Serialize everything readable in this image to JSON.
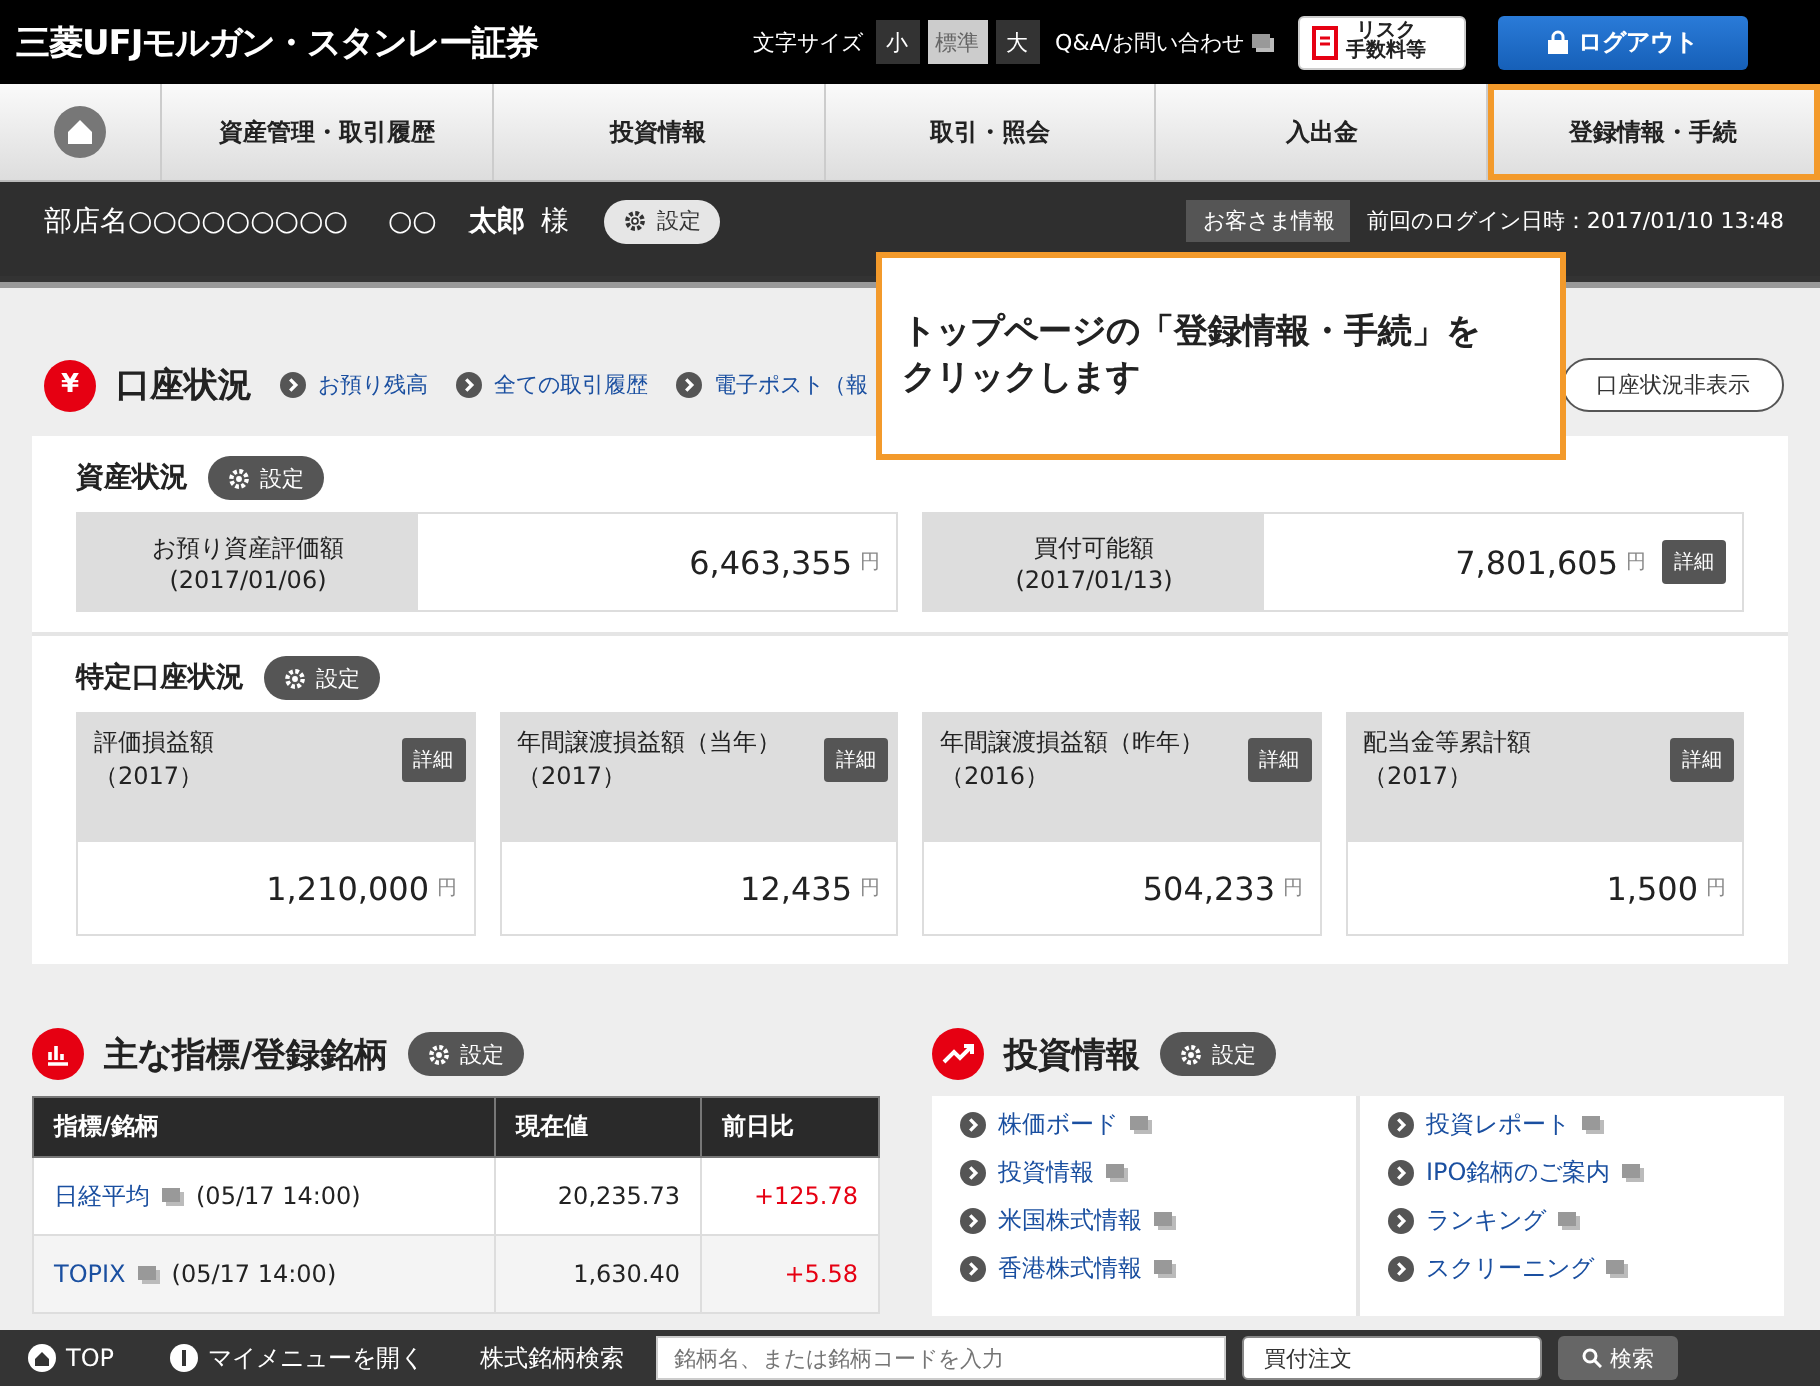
{
  "header": {
    "logo": "三菱UFJモルガン・スタンレー証券",
    "font_size_label": "文字サイズ",
    "font_sizes": [
      {
        "label": "小",
        "selected": false
      },
      {
        "label": "標準",
        "selected": true
      },
      {
        "label": "大",
        "selected": false
      }
    ],
    "help_link": "Q&A/お問い合わせ",
    "risk_button": [
      "リスク",
      "手数料等"
    ],
    "logout_button": "ログアウト"
  },
  "nav": [
    {
      "label": "資産管理・取引履歴",
      "highlighted": false
    },
    {
      "label": "投資情報",
      "highlighted": false
    },
    {
      "label": "取引・照会",
      "highlighted": false
    },
    {
      "label": "入出金",
      "highlighted": false
    },
    {
      "label": "登録情報・手続",
      "highlighted": true
    }
  ],
  "user_bar": {
    "branch": "部店名○○○○○○○○○",
    "surname": "○○",
    "given_name": "太郎",
    "honorific": "様",
    "settings": "設定",
    "customer_info": "お客さま情報",
    "last_login": "前回のログイン日時：2017/01/10 13:48"
  },
  "callout": {
    "lines": [
      "トップページの「登録情報・手続」を",
      "クリックします"
    ]
  },
  "account": {
    "icon": "¥",
    "title": "口座状況",
    "links": [
      "お預り残高",
      "全ての取引履歴",
      "電子ポスト（報"
    ],
    "hide_button": "口座状況非表示",
    "assets": {
      "title": "資産状況",
      "settings": "設定",
      "items": [
        {
          "label": "お預り資産評価額",
          "date": "(2017/01/06)",
          "value": "6,463,355",
          "unit": "円"
        },
        {
          "label": "買付可能額",
          "date": "(2017/01/13)",
          "value": "7,801,605",
          "unit": "円",
          "detail": "詳細"
        }
      ]
    },
    "specific": {
      "title": "特定口座状況",
      "settings": "設定",
      "items": [
        {
          "label": "評価損益額",
          "date": "（2017）",
          "value": "1,210,000",
          "unit": "円",
          "detail": "詳細"
        },
        {
          "label": "年間譲渡損益額（当年）",
          "date": "（2017）",
          "value": "12,435",
          "unit": "円",
          "detail": "詳細"
        },
        {
          "label": "年間譲渡損益額（昨年）",
          "date": "（2016）",
          "value": "504,233",
          "unit": "円",
          "detail": "詳細"
        },
        {
          "label": "配当金等累計額",
          "date": "（2017）",
          "value": "1,500",
          "unit": "円",
          "detail": "詳細"
        }
      ]
    }
  },
  "indices": {
    "title": "主な指標/登録銘柄",
    "settings": "設定",
    "columns": [
      "指標/銘柄",
      "現在値",
      "前日比"
    ],
    "rows": [
      {
        "name": "日経平均",
        "time": "(05/17 14:00)",
        "price": "20,235.73",
        "change": "+125.78"
      },
      {
        "name": "TOPIX",
        "time": "(05/17 14:00)",
        "price": "1,630.40",
        "change": "+5.58"
      }
    ]
  },
  "investment": {
    "title": "投資情報",
    "settings": "設定",
    "columns": [
      [
        "株価ボード",
        "投資情報",
        "米国株式情報",
        "香港株式情報"
      ],
      [
        "投資レポート",
        "IPO銘柄のご案内",
        "ランキング",
        "スクリーニング"
      ]
    ]
  },
  "bottom_bar": {
    "top": "TOP",
    "my_menu": "マイメニューを開く",
    "search_label": "株式銘柄検索",
    "search_placeholder": "銘柄名、または銘柄コードを入力",
    "order_type": "買付注文",
    "search_button": "検索"
  }
}
